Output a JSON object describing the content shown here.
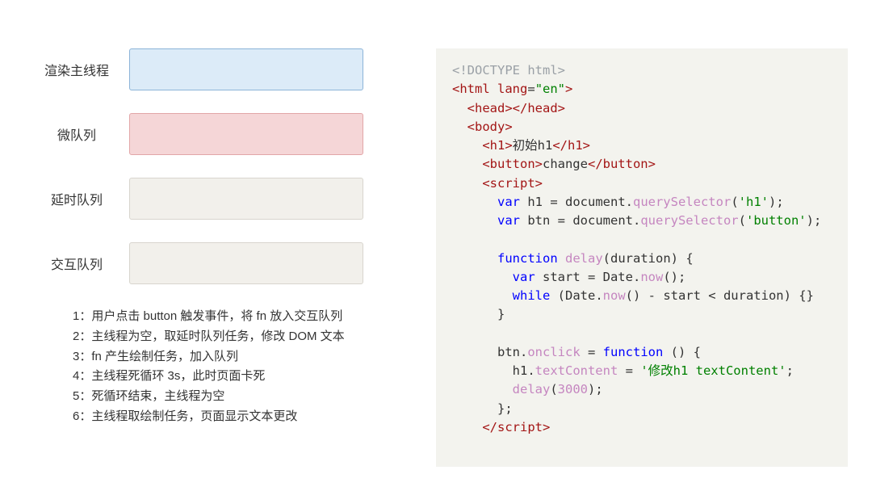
{
  "queues": [
    {
      "label": "渲染主线程",
      "box_class": "box-blue"
    },
    {
      "label": "微队列",
      "box_class": "box-red"
    },
    {
      "label": "延时队列",
      "box_class": "box-grey"
    },
    {
      "label": "交互队列",
      "box_class": "box-grey"
    }
  ],
  "steps": [
    "1：用户点击 button 触发事件，将 fn 放入交互队列",
    "2：主线程为空，取延时队列任务，修改 DOM 文本",
    "3：fn 产生绘制任务，加入队列",
    "4：主线程死循环 3s，此时页面卡死",
    "5：死循环结束，主线程为空",
    "6：主线程取绘制任务，页面显示文本更改"
  ],
  "code": {
    "l1": "<!DOCTYPE html>",
    "l2a": "<html",
    "l2b": " lang",
    "l2c": "=",
    "l2d": "\"en\"",
    "l2e": ">",
    "l3a": "<head>",
    "l3b": "</head>",
    "l4": "<body>",
    "l5a": "<h1>",
    "l5b": "初始h1",
    "l5c": "</h1>",
    "l6a": "<button>",
    "l6b": "change",
    "l6c": "</button>",
    "l7": "<script>",
    "l8a": "var",
    "l8b": " h1 = document.",
    "l8c": "querySelector",
    "l8d": "(",
    "l8e": "'h1'",
    "l8f": ");",
    "l9a": "var",
    "l9b": " btn = document.",
    "l9c": "querySelector",
    "l9d": "(",
    "l9e": "'button'",
    "l9f": ");",
    "l10a": "function",
    "l10b": " ",
    "l10c": "delay",
    "l10d": "(duration) {",
    "l11a": "var",
    "l11b": " start = Date.",
    "l11c": "now",
    "l11d": "();",
    "l12a": "while",
    "l12b": " (Date.",
    "l12c": "now",
    "l12d": "() - start < duration) {}",
    "l13": "}",
    "l14a": "btn.",
    "l14b": "onclick",
    "l14c": " = ",
    "l14d": "function",
    "l14e": " () {",
    "l15a": "h1.",
    "l15b": "textContent",
    "l15c": " = ",
    "l15d": "'修改h1 textContent'",
    "l15e": ";",
    "l16a": "delay",
    "l16b": "(",
    "l16c": "3000",
    "l16d": ");",
    "l17": "};",
    "l18": "</script>"
  }
}
